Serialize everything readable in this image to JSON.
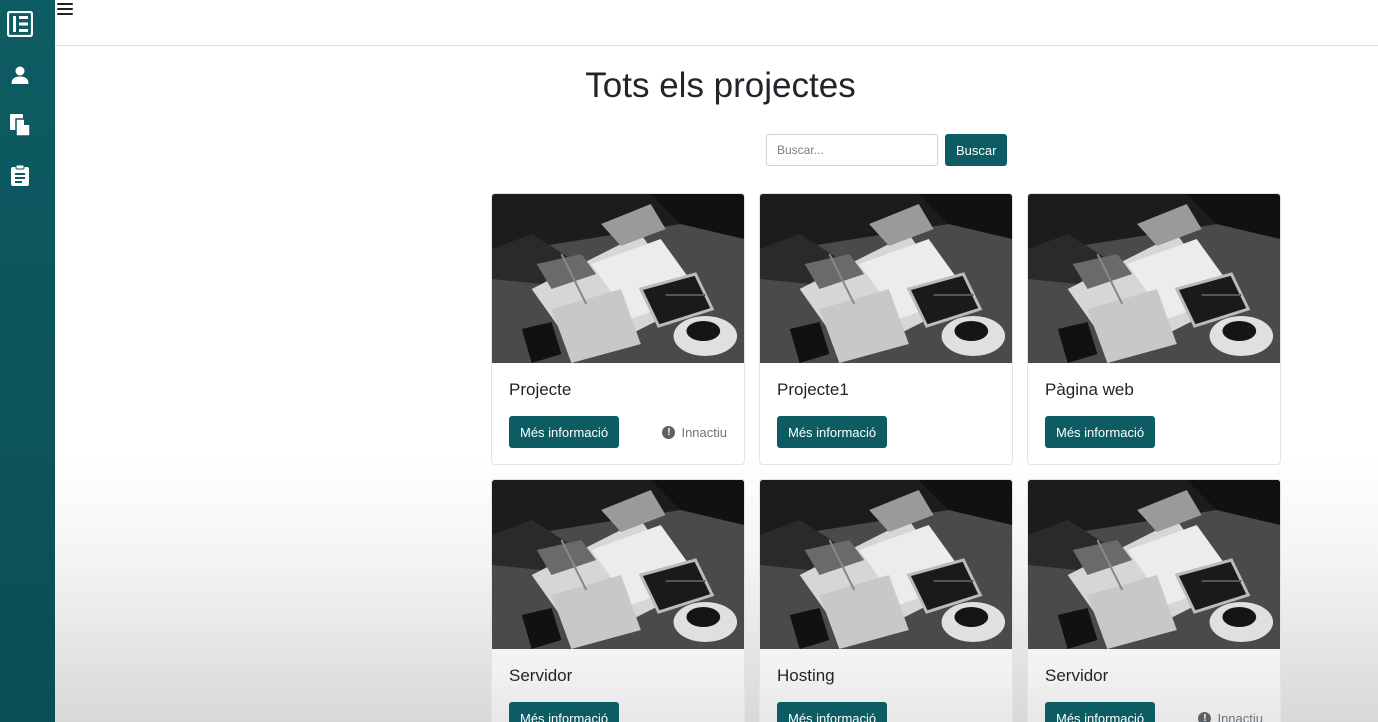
{
  "header": {
    "title": "Tots els projectes"
  },
  "search": {
    "placeholder": "Buscar...",
    "button_label": "Buscar"
  },
  "sidebar": {
    "items": [
      {
        "icon": "logo-icon"
      },
      {
        "icon": "user-icon"
      },
      {
        "icon": "files-icon"
      },
      {
        "icon": "clipboard-icon"
      }
    ]
  },
  "colors": {
    "accent": "#0e5c63"
  },
  "projects": [
    {
      "title": "Projecte",
      "button_label": "Més informació",
      "status": "Innactiu"
    },
    {
      "title": "Projecte1",
      "button_label": "Més informació",
      "status": ""
    },
    {
      "title": "Pàgina web",
      "button_label": "Més informació",
      "status": ""
    },
    {
      "title": "Servidor",
      "button_label": "Més informació",
      "status": ""
    },
    {
      "title": "Hosting",
      "button_label": "Més informació",
      "status": ""
    },
    {
      "title": "Servidor",
      "button_label": "Més informació",
      "status": "Innactiu"
    }
  ]
}
